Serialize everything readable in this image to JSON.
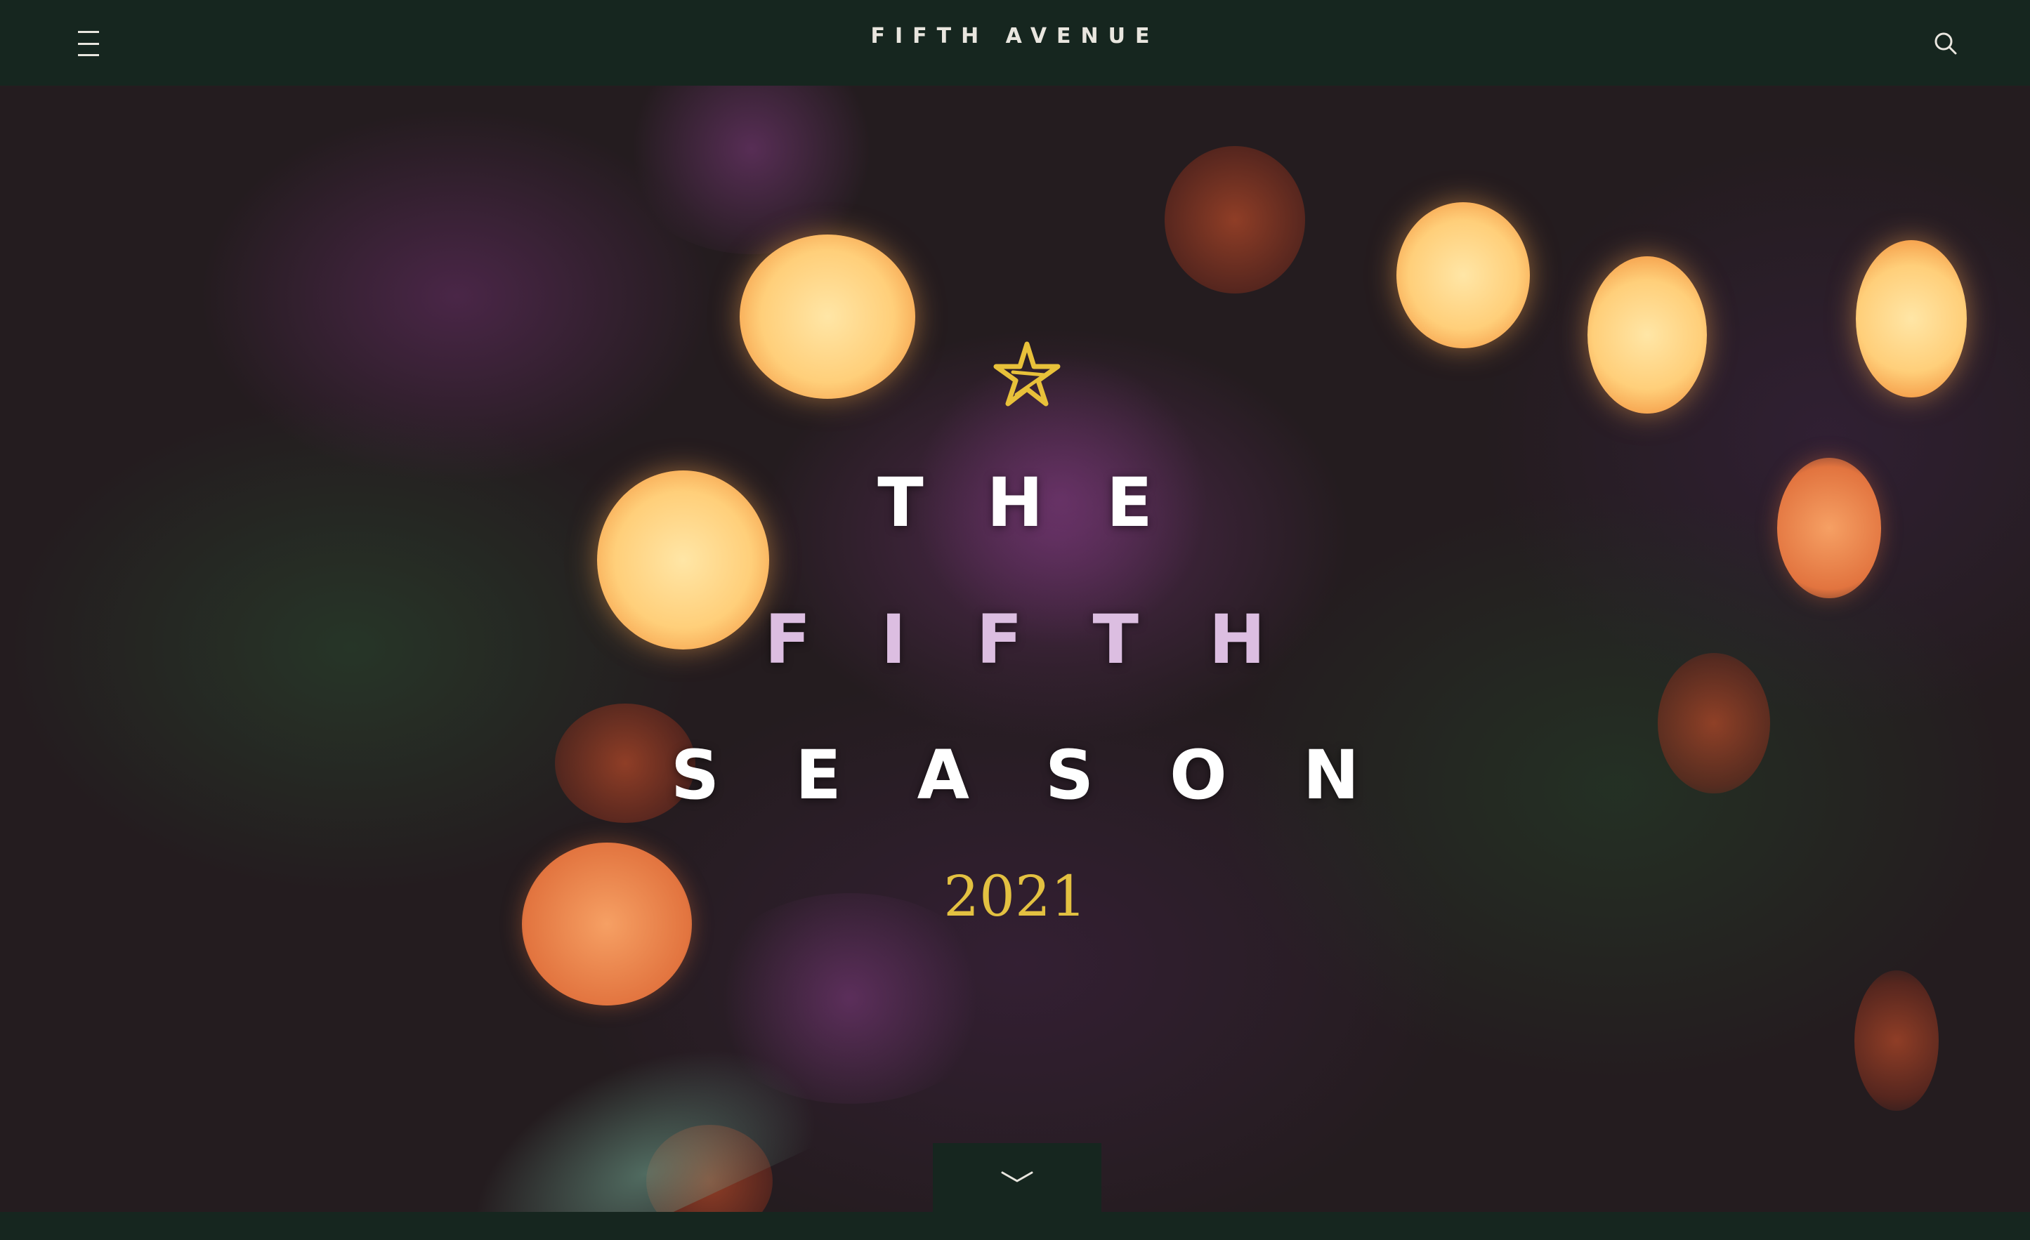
{
  "header": {
    "brand": "FIFTH AVENUE",
    "menu_icon": "hamburger-menu-icon",
    "search_icon": "search-icon"
  },
  "hero": {
    "icon": "star-icon",
    "line1": "THE",
    "line2": "FIFTH",
    "line3": "SEASON",
    "year": "2021",
    "scroll_icon": "chevron-down-icon"
  },
  "colors": {
    "nav_bg": "#16261f",
    "nav_text": "#e9e6df",
    "headline_white": "#ffffff",
    "headline_lilac": "#dcbee1",
    "year_gold": "#e3c141",
    "star_gold": "#e8c13a"
  }
}
